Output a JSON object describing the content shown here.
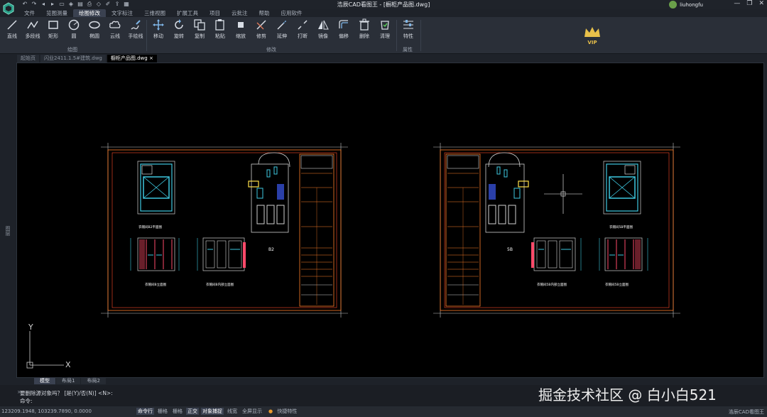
{
  "titlebar": {
    "title": "浩辰CAD看图王 - [橱柜产品图.dwg]",
    "user": "liuhongfu",
    "quick_access": [
      "↶",
      "↷",
      "◂",
      "▸",
      "▭",
      "◈",
      "▤",
      "⎙",
      "◇",
      "✐",
      "⇪",
      "▦"
    ]
  },
  "menu": {
    "tabs": [
      "文件",
      "览图测量",
      "绘图修改",
      "文字标注",
      "三维视图",
      "扩展工具",
      "项目",
      "云批注",
      "帮助",
      "应用软件"
    ],
    "active_index": 2
  },
  "ribbon": {
    "draw_tools": [
      "直线",
      "多段线",
      "矩形",
      "圆",
      "椭圆",
      "云线",
      "手绘线"
    ],
    "modify_tools": [
      "移动",
      "旋转",
      "复制",
      "粘贴",
      "缩放",
      "修剪",
      "延伸",
      "打断",
      "镜像",
      "偏移",
      "删除",
      "清理"
    ],
    "property_tools": [
      "特性"
    ],
    "groups": [
      "绘图",
      "修改",
      "属性"
    ],
    "vip": "VIP"
  },
  "doc_tabs": [
    "起始页",
    "闪业2411.1.5#建筑.dwg",
    "橱柜产品图.dwg"
  ],
  "doc_tab_active": 2,
  "side_label": "图层",
  "drawing": {
    "left_sheet_note": "B2",
    "right_sheet_note": "5B",
    "captions_left": [
      "衣帽间B2平面图",
      "衣帽间B立面图",
      "衣帽间B内部立面图"
    ],
    "captions_right": [
      "衣帽间5B平面图",
      "衣帽间5B内部立面图",
      "衣帽间5B立面图"
    ],
    "ucs_x": "X",
    "ucs_y": "Y"
  },
  "layout_tabs": [
    "模型",
    "布局1",
    "布局2"
  ],
  "layout_active": 0,
  "command": {
    "history": "要删除源对象吗？ [是(Y)/否(N)] <N>:",
    "prompt": "命令:"
  },
  "status": {
    "coords": "123209.1948, 103239.7890, 0.0000",
    "toggles": [
      "命令行",
      "栅格",
      "栅格",
      "正交",
      "对象捕捉",
      "线宽",
      "全屏显示",
      "快捷特性"
    ],
    "toggles_on": [
      0,
      3,
      4
    ],
    "app_name": "浩辰CAD看图王"
  },
  "watermark": "掘金技术社区 @ 白小白521"
}
